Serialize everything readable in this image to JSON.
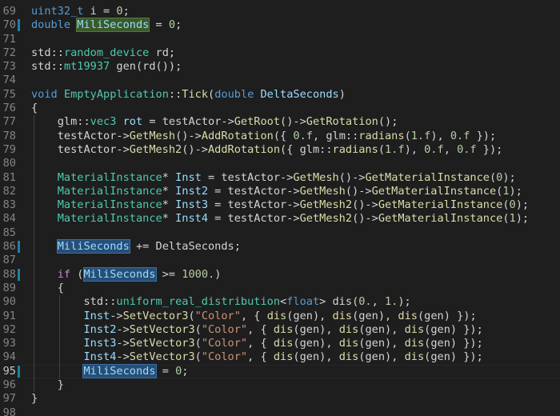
{
  "editor": {
    "current_line": "95",
    "lines": [
      {
        "num": "69",
        "tokens": [
          {
            "t": "uint32_t",
            "c": "kw"
          },
          {
            "t": " i = ",
            "c": "tk"
          },
          {
            "t": "0",
            "c": "num"
          },
          {
            "t": ";",
            "c": "tk"
          }
        ]
      },
      {
        "num": "70",
        "mark": true,
        "tokens": [
          {
            "t": "double",
            "c": "kw"
          },
          {
            "t": " ",
            "c": "tk"
          },
          {
            "t": "MiliSeconds",
            "c": "hlg"
          },
          {
            "t": " = ",
            "c": "tk"
          },
          {
            "t": "0",
            "c": "num"
          },
          {
            "t": ";",
            "c": "tk"
          }
        ]
      },
      {
        "num": "71",
        "tokens": []
      },
      {
        "num": "72",
        "tokens": [
          {
            "t": "std",
            "c": "tk"
          },
          {
            "t": "::",
            "c": "tk"
          },
          {
            "t": "random_device",
            "c": "ty"
          },
          {
            "t": " rd;",
            "c": "tk"
          }
        ]
      },
      {
        "num": "73",
        "tokens": [
          {
            "t": "std",
            "c": "tk"
          },
          {
            "t": "::",
            "c": "tk"
          },
          {
            "t": "mt19937",
            "c": "ty"
          },
          {
            "t": " ",
            "c": "tk"
          },
          {
            "t": "gen",
            "c": "tk"
          },
          {
            "t": "(rd());",
            "c": "tk"
          }
        ]
      },
      {
        "num": "74",
        "tokens": []
      },
      {
        "num": "75",
        "tokens": [
          {
            "t": "void",
            "c": "kw"
          },
          {
            "t": " ",
            "c": "tk"
          },
          {
            "t": "EmptyApplication",
            "c": "ty"
          },
          {
            "t": "::",
            "c": "tk"
          },
          {
            "t": "Tick",
            "c": "fn"
          },
          {
            "t": "(",
            "c": "tk"
          },
          {
            "t": "double",
            "c": "kw"
          },
          {
            "t": " ",
            "c": "tk"
          },
          {
            "t": "DeltaSeconds",
            "c": "prm"
          },
          {
            "t": ")",
            "c": "tk"
          }
        ]
      },
      {
        "num": "76",
        "tokens": [
          {
            "t": "{",
            "c": "tk"
          }
        ]
      },
      {
        "num": "77",
        "tokens": [
          {
            "t": "    glm",
            "c": "tk"
          },
          {
            "t": "::",
            "c": "tk"
          },
          {
            "t": "vec3",
            "c": "ty"
          },
          {
            "t": " ",
            "c": "tk"
          },
          {
            "t": "rot",
            "c": "var"
          },
          {
            "t": " = testActor->",
            "c": "tk"
          },
          {
            "t": "GetRoot",
            "c": "fn"
          },
          {
            "t": "()->",
            "c": "tk"
          },
          {
            "t": "GetRotation",
            "c": "fn"
          },
          {
            "t": "();",
            "c": "tk"
          }
        ]
      },
      {
        "num": "78",
        "tokens": [
          {
            "t": "    testActor->",
            "c": "tk"
          },
          {
            "t": "GetMesh",
            "c": "fn"
          },
          {
            "t": "()->",
            "c": "tk"
          },
          {
            "t": "AddRotation",
            "c": "fn"
          },
          {
            "t": "({ ",
            "c": "tk"
          },
          {
            "t": "0.f",
            "c": "num"
          },
          {
            "t": ", glm::",
            "c": "tk"
          },
          {
            "t": "radians",
            "c": "fn"
          },
          {
            "t": "(",
            "c": "tk"
          },
          {
            "t": "1.f",
            "c": "num"
          },
          {
            "t": "), ",
            "c": "tk"
          },
          {
            "t": "0.f",
            "c": "num"
          },
          {
            "t": " });",
            "c": "tk"
          }
        ]
      },
      {
        "num": "79",
        "tokens": [
          {
            "t": "    testActor->",
            "c": "tk"
          },
          {
            "t": "GetMesh2",
            "c": "fn"
          },
          {
            "t": "()->",
            "c": "tk"
          },
          {
            "t": "AddRotation",
            "c": "fn"
          },
          {
            "t": "({ glm::",
            "c": "tk"
          },
          {
            "t": "radians",
            "c": "fn"
          },
          {
            "t": "(",
            "c": "tk"
          },
          {
            "t": "1.f",
            "c": "num"
          },
          {
            "t": "), ",
            "c": "tk"
          },
          {
            "t": "0.f",
            "c": "num"
          },
          {
            "t": ", ",
            "c": "tk"
          },
          {
            "t": "0.f",
            "c": "num"
          },
          {
            "t": " });",
            "c": "tk"
          }
        ]
      },
      {
        "num": "80",
        "tokens": []
      },
      {
        "num": "81",
        "tokens": [
          {
            "t": "    ",
            "c": "tk"
          },
          {
            "t": "MaterialInstance",
            "c": "ty"
          },
          {
            "t": "* ",
            "c": "tk"
          },
          {
            "t": "Inst",
            "c": "var"
          },
          {
            "t": " = testActor->",
            "c": "tk"
          },
          {
            "t": "GetMesh",
            "c": "fn"
          },
          {
            "t": "()->",
            "c": "tk"
          },
          {
            "t": "GetMaterialInstance",
            "c": "fn"
          },
          {
            "t": "(",
            "c": "tk"
          },
          {
            "t": "0",
            "c": "num"
          },
          {
            "t": ");",
            "c": "tk"
          }
        ]
      },
      {
        "num": "82",
        "tokens": [
          {
            "t": "    ",
            "c": "tk"
          },
          {
            "t": "MaterialInstance",
            "c": "ty"
          },
          {
            "t": "* ",
            "c": "tk"
          },
          {
            "t": "Inst2",
            "c": "var"
          },
          {
            "t": " = testActor->",
            "c": "tk"
          },
          {
            "t": "GetMesh",
            "c": "fn"
          },
          {
            "t": "()->",
            "c": "tk"
          },
          {
            "t": "GetMaterialInstance",
            "c": "fn"
          },
          {
            "t": "(",
            "c": "tk"
          },
          {
            "t": "1",
            "c": "num"
          },
          {
            "t": ");",
            "c": "tk"
          }
        ]
      },
      {
        "num": "83",
        "tokens": [
          {
            "t": "    ",
            "c": "tk"
          },
          {
            "t": "MaterialInstance",
            "c": "ty"
          },
          {
            "t": "* ",
            "c": "tk"
          },
          {
            "t": "Inst3",
            "c": "var"
          },
          {
            "t": " = testActor->",
            "c": "tk"
          },
          {
            "t": "GetMesh2",
            "c": "fn"
          },
          {
            "t": "()->",
            "c": "tk"
          },
          {
            "t": "GetMaterialInstance",
            "c": "fn"
          },
          {
            "t": "(",
            "c": "tk"
          },
          {
            "t": "0",
            "c": "num"
          },
          {
            "t": ");",
            "c": "tk"
          }
        ]
      },
      {
        "num": "84",
        "tokens": [
          {
            "t": "    ",
            "c": "tk"
          },
          {
            "t": "MaterialInstance",
            "c": "ty"
          },
          {
            "t": "* ",
            "c": "tk"
          },
          {
            "t": "Inst4",
            "c": "var"
          },
          {
            "t": " = testActor->",
            "c": "tk"
          },
          {
            "t": "GetMesh2",
            "c": "fn"
          },
          {
            "t": "()->",
            "c": "tk"
          },
          {
            "t": "GetMaterialInstance",
            "c": "fn"
          },
          {
            "t": "(",
            "c": "tk"
          },
          {
            "t": "1",
            "c": "num"
          },
          {
            "t": ");",
            "c": "tk"
          }
        ]
      },
      {
        "num": "85",
        "tokens": []
      },
      {
        "num": "86",
        "mark": true,
        "tokens": [
          {
            "t": "    ",
            "c": "tk"
          },
          {
            "t": "MiliSeconds",
            "c": "hl"
          },
          {
            "t": " += DeltaSeconds;",
            "c": "tk"
          }
        ]
      },
      {
        "num": "87",
        "tokens": []
      },
      {
        "num": "88",
        "mark": true,
        "tokens": [
          {
            "t": "    ",
            "c": "tk"
          },
          {
            "t": "if",
            "c": "ctl"
          },
          {
            "t": " (",
            "c": "tk"
          },
          {
            "t": "MiliSeconds",
            "c": "hl"
          },
          {
            "t": " >= ",
            "c": "tk"
          },
          {
            "t": "1000.",
            "c": "num"
          },
          {
            "t": ")",
            "c": "tk"
          }
        ]
      },
      {
        "num": "89",
        "tokens": [
          {
            "t": "    {",
            "c": "tk"
          }
        ]
      },
      {
        "num": "90",
        "tokens": [
          {
            "t": "        std::",
            "c": "tk"
          },
          {
            "t": "uniform_real_distribution",
            "c": "ty"
          },
          {
            "t": "<",
            "c": "tk"
          },
          {
            "t": "float",
            "c": "kw"
          },
          {
            "t": "> ",
            "c": "tk"
          },
          {
            "t": "dis",
            "c": "tk"
          },
          {
            "t": "(",
            "c": "tk"
          },
          {
            "t": "0.",
            "c": "num"
          },
          {
            "t": ", ",
            "c": "tk"
          },
          {
            "t": "1.",
            "c": "num"
          },
          {
            "t": ");",
            "c": "tk"
          }
        ]
      },
      {
        "num": "91",
        "tokens": [
          {
            "t": "        ",
            "c": "tk"
          },
          {
            "t": "Inst",
            "c": "var"
          },
          {
            "t": "->",
            "c": "tk"
          },
          {
            "t": "SetVector3",
            "c": "fn"
          },
          {
            "t": "(",
            "c": "tk"
          },
          {
            "t": "\"Color\"",
            "c": "str"
          },
          {
            "t": ", { ",
            "c": "tk"
          },
          {
            "t": "dis",
            "c": "fn"
          },
          {
            "t": "(gen), ",
            "c": "tk"
          },
          {
            "t": "dis",
            "c": "fn"
          },
          {
            "t": "(gen), ",
            "c": "tk"
          },
          {
            "t": "dis",
            "c": "fn"
          },
          {
            "t": "(gen) });",
            "c": "tk"
          }
        ]
      },
      {
        "num": "92",
        "tokens": [
          {
            "t": "        ",
            "c": "tk"
          },
          {
            "t": "Inst2",
            "c": "var"
          },
          {
            "t": "->",
            "c": "tk"
          },
          {
            "t": "SetVector3",
            "c": "fn"
          },
          {
            "t": "(",
            "c": "tk"
          },
          {
            "t": "\"Color\"",
            "c": "str"
          },
          {
            "t": ", { ",
            "c": "tk"
          },
          {
            "t": "dis",
            "c": "fn"
          },
          {
            "t": "(gen), ",
            "c": "tk"
          },
          {
            "t": "dis",
            "c": "fn"
          },
          {
            "t": "(gen), ",
            "c": "tk"
          },
          {
            "t": "dis",
            "c": "fn"
          },
          {
            "t": "(gen) });",
            "c": "tk"
          }
        ]
      },
      {
        "num": "93",
        "tokens": [
          {
            "t": "        ",
            "c": "tk"
          },
          {
            "t": "Inst3",
            "c": "var"
          },
          {
            "t": "->",
            "c": "tk"
          },
          {
            "t": "SetVector3",
            "c": "fn"
          },
          {
            "t": "(",
            "c": "tk"
          },
          {
            "t": "\"Color\"",
            "c": "str"
          },
          {
            "t": ", { ",
            "c": "tk"
          },
          {
            "t": "dis",
            "c": "fn"
          },
          {
            "t": "(gen), ",
            "c": "tk"
          },
          {
            "t": "dis",
            "c": "fn"
          },
          {
            "t": "(gen), ",
            "c": "tk"
          },
          {
            "t": "dis",
            "c": "fn"
          },
          {
            "t": "(gen) });",
            "c": "tk"
          }
        ]
      },
      {
        "num": "94",
        "tokens": [
          {
            "t": "        ",
            "c": "tk"
          },
          {
            "t": "Inst4",
            "c": "var"
          },
          {
            "t": "->",
            "c": "tk"
          },
          {
            "t": "SetVector3",
            "c": "fn"
          },
          {
            "t": "(",
            "c": "tk"
          },
          {
            "t": "\"Color\"",
            "c": "str"
          },
          {
            "t": ", { ",
            "c": "tk"
          },
          {
            "t": "dis",
            "c": "fn"
          },
          {
            "t": "(gen), ",
            "c": "tk"
          },
          {
            "t": "dis",
            "c": "fn"
          },
          {
            "t": "(gen), ",
            "c": "tk"
          },
          {
            "t": "dis",
            "c": "fn"
          },
          {
            "t": "(gen) });",
            "c": "tk"
          }
        ]
      },
      {
        "num": "95",
        "mark": true,
        "current": true,
        "tokens": [
          {
            "t": "        ",
            "c": "tk"
          },
          {
            "t": "MiliSeconds",
            "c": "hl"
          },
          {
            "t": " = ",
            "c": "tk"
          },
          {
            "t": "0",
            "c": "num"
          },
          {
            "t": ";",
            "c": "tk"
          }
        ]
      },
      {
        "num": "96",
        "tokens": [
          {
            "t": "    }",
            "c": "tk"
          }
        ]
      },
      {
        "num": "97",
        "tokens": [
          {
            "t": "}",
            "c": "tk"
          }
        ]
      },
      {
        "num": "98",
        "tokens": []
      }
    ]
  }
}
